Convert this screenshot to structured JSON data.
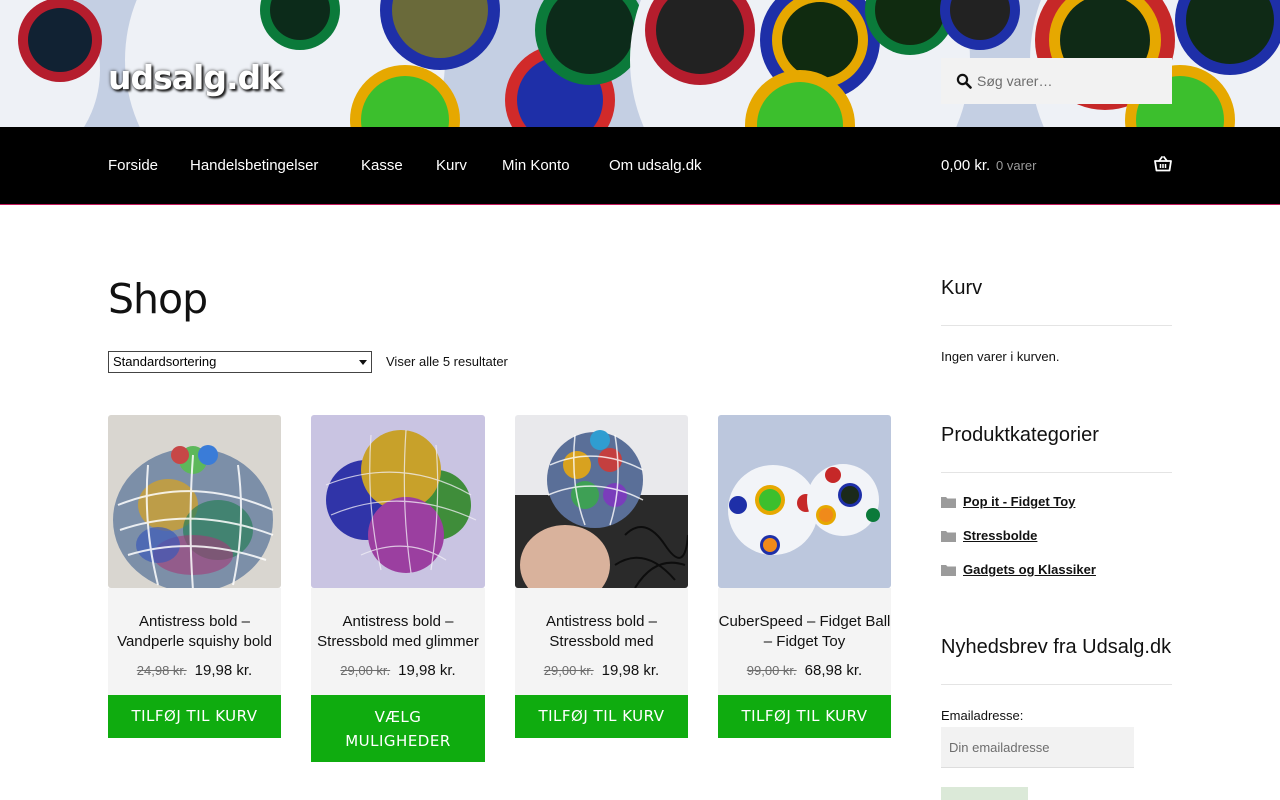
{
  "header": {
    "site_title": "udsalg.dk",
    "search_placeholder": "Søg varer…"
  },
  "nav": {
    "items": [
      {
        "label": "Forside"
      },
      {
        "label": "Handelsbetingelser"
      },
      {
        "label": "Kasse"
      },
      {
        "label": "Kurv"
      },
      {
        "label": "Min Konto"
      },
      {
        "label": "Om udsalg.dk"
      }
    ],
    "cart_total": "0,00 kr.",
    "cart_count": "0 varer"
  },
  "main": {
    "title": "Shop",
    "orderby_selected": "Standardsortering",
    "result_count": "Viser alle 5 resultater",
    "products": [
      {
        "title": "Antistress bold – Vandperle squishy bold",
        "old_price": "24,98 kr.",
        "price": "19,98 kr.",
        "button": "TILFØJ TIL KURV",
        "image": "mesh-ball-multicolor"
      },
      {
        "title": "Antistress bold – Stressbold med glimmer",
        "old_price": "29,00 kr.",
        "price": "19,98 kr.",
        "button": "VÆLG MULIGHEDER",
        "image": "glitter-mesh-balls"
      },
      {
        "title": "Antistress bold – Stressbold med vandperler",
        "old_price": "29,00 kr.",
        "price": "19,98 kr.",
        "button": "TILFØJ TIL KURV",
        "image": "mesh-ball-in-hand"
      },
      {
        "title": "CuberSpeed – Fidget Ball – Fidget Toy",
        "old_price": "99,00 kr.",
        "price": "68,98 kr.",
        "button": "TILFØJ TIL KURV",
        "image": "rainbow-puzzle-balls"
      }
    ]
  },
  "sidebar": {
    "cart_title": "Kurv",
    "cart_empty": "Ingen varer i kurven.",
    "categories_title": "Produktkategorier",
    "categories": [
      {
        "label": "Pop it - Fidget Toy"
      },
      {
        "label": "Stressbolde"
      },
      {
        "label": "Gadgets og Klassiker"
      }
    ],
    "newsletter_title": "Nyhedsbrev fra Udsalg.dk",
    "email_label": "Emailadresse:",
    "email_placeholder": "Din emailadresse"
  },
  "colors": {
    "nav_bg": "#000000",
    "button_green": "#0fac0f",
    "nav_accent": "#c2185b"
  }
}
